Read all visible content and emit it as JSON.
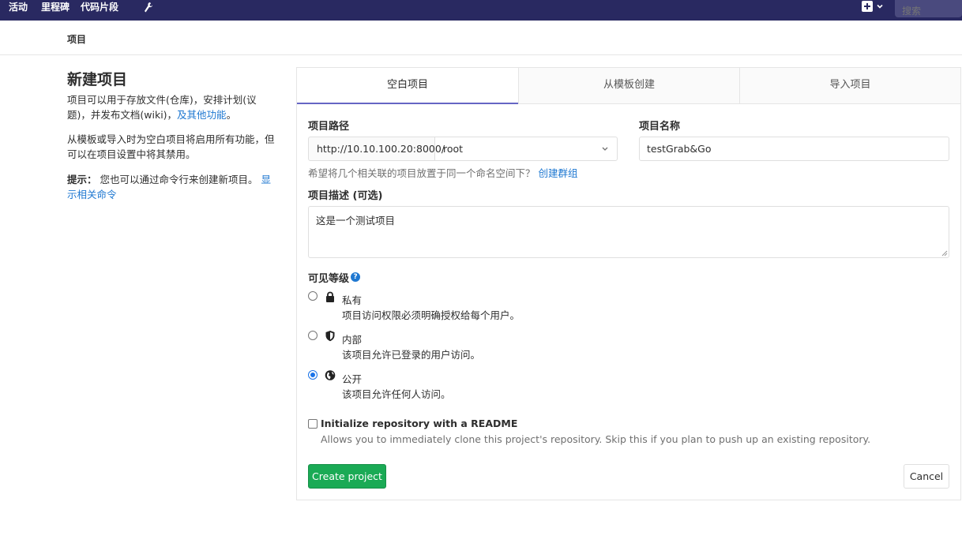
{
  "navbar": {
    "items": [
      "活动",
      "里程碑",
      "代码片段"
    ],
    "wrench_icon": "wrench-icon",
    "plus_icon": "plus-square-icon",
    "caret_icon": "chevron-down-icon",
    "search_placeholder": "搜索",
    "bg_color": "#292961"
  },
  "breadcrumb": {
    "label": "项目"
  },
  "intro": {
    "title": "新建项目",
    "para1_text": "项目可以用于存放文件(仓库)，安排计划(议题)，并发布文档(wiki)，",
    "para1_link": "及其他功能",
    "para1_end": "。",
    "para2": "从模板或导入时为空白项目将启用所有功能，但可以在项目设置中将其禁用。",
    "tip_label": "提示：",
    "tip_text": "您也可以通过命令行来创建新项目。",
    "tip_link": "显示相关命令"
  },
  "tabs": [
    "空白项目",
    "从模板创建",
    "导入项目"
  ],
  "form": {
    "path_label": "项目路径",
    "path_prefix": "http://10.10.100.20:8000/",
    "namespace_value": "root",
    "name_label": "项目名称",
    "name_value": "testGrab&Go",
    "group_help": "希望将几个相关联的项目放置于同一个命名空间下？",
    "group_link": "创建群组",
    "desc_label": "项目描述 (可选)",
    "desc_value": "这是一个测试项目",
    "visibility_label": "可见等级",
    "visibility_help_icon": "question-circle-icon",
    "visibility_options": [
      {
        "title": "私有",
        "desc": "项目访问权限必须明确授权给每个用户。",
        "icon": "lock-icon",
        "checked": false
      },
      {
        "title": "内部",
        "desc": "该项目允许已登录的用户访问。",
        "icon": "shield-icon",
        "checked": false
      },
      {
        "title": "公开",
        "desc": "该项目允许任何人访问。",
        "icon": "globe-icon",
        "checked": true
      }
    ],
    "readme_label": "Initialize repository with a README",
    "readme_desc": "Allows you to immediately clone this project's repository. Skip this if you plan to push up an existing repository.",
    "readme_checked": false,
    "create_button": "Create project",
    "cancel_button": "Cancel"
  },
  "colors": {
    "accent": "#1f78d1",
    "create_green": "#1aaa55",
    "tab_active": "#6666c4"
  }
}
